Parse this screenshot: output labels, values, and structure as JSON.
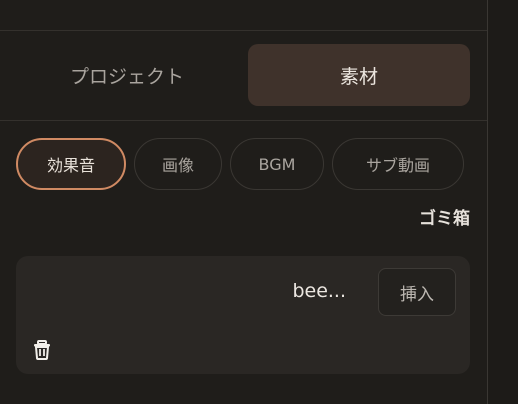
{
  "tabs": {
    "project": "プロジェクト",
    "material": "素材"
  },
  "filters": [
    {
      "label": "効果音",
      "active": true
    },
    {
      "label": "画像",
      "active": false
    },
    {
      "label": "BGM",
      "active": false
    },
    {
      "label": "サブ動画",
      "active": false
    }
  ],
  "trash_link": "ゴミ箱",
  "asset": {
    "name": "bee...",
    "insert_label": "挿入",
    "delete_icon": "trash-icon"
  },
  "colors": {
    "accent_border": "#d08a63",
    "active_tab_bg": "#3f322b",
    "background": "#1f1d1a",
    "card_bg": "#2a2724"
  }
}
